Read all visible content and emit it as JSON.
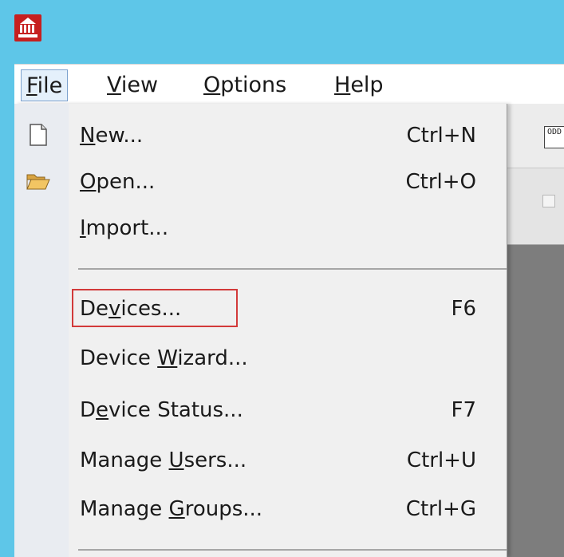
{
  "menubar": {
    "items": [
      {
        "label": "File",
        "mnemonic": "F",
        "rest": "ile"
      },
      {
        "label": "View",
        "mnemonic": "V",
        "rest": "iew"
      },
      {
        "label": "Options",
        "mnemonic": "O",
        "rest": "ptions"
      },
      {
        "label": "Help",
        "mnemonic": "H",
        "rest": "elp"
      }
    ]
  },
  "file_menu": {
    "items": [
      {
        "pre": "",
        "mn": "N",
        "post": "ew...",
        "shortcut": "Ctrl+N",
        "icon": "new-document-icon"
      },
      {
        "pre": "",
        "mn": "O",
        "post": "pen...",
        "shortcut": "Ctrl+O",
        "icon": "open-folder-icon"
      },
      {
        "pre": "",
        "mn": "I",
        "post": "mport...",
        "shortcut": ""
      },
      {
        "pre": "De",
        "mn": "v",
        "post": "ices...",
        "shortcut": "F6"
      },
      {
        "pre": "Device ",
        "mn": "W",
        "post": "izard...",
        "shortcut": ""
      },
      {
        "pre": "D",
        "mn": "e",
        "post": "vice Status...",
        "shortcut": "F7"
      },
      {
        "pre": "Manage ",
        "mn": "U",
        "post": "sers...",
        "shortcut": "Ctrl+U"
      },
      {
        "pre": "Manage ",
        "mn": "G",
        "post": "roups...",
        "shortcut": "Ctrl+G"
      }
    ]
  },
  "toolbar": {
    "icon_text": "ODD"
  },
  "colors": {
    "titlebar": "#5ec6e8",
    "highlight": "#d23a3a",
    "app_icon": "#c61f1f"
  }
}
